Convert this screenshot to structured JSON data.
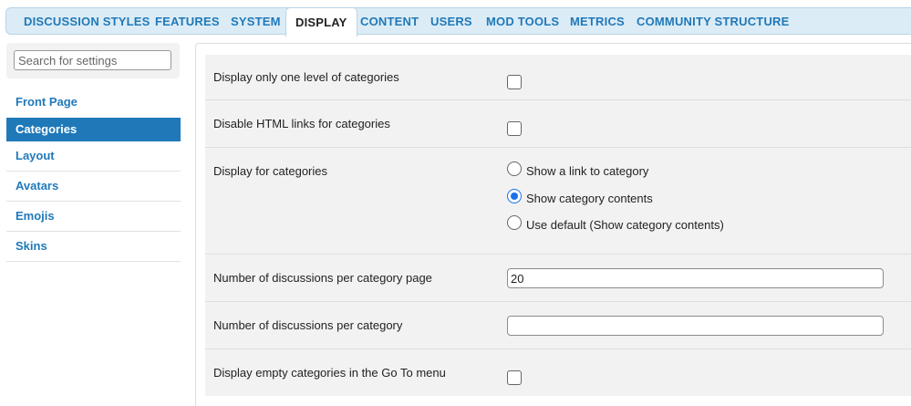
{
  "tabs": [
    {
      "label": "DISCUSSION STYLES",
      "active": false
    },
    {
      "label": "FEATURES",
      "active": false
    },
    {
      "label": "SYSTEM",
      "active": false
    },
    {
      "label": "DISPLAY",
      "active": true
    },
    {
      "label": "CONTENT",
      "active": false
    },
    {
      "label": "USERS",
      "active": false
    },
    {
      "label": "MOD TOOLS",
      "active": false
    },
    {
      "label": "METRICS",
      "active": false
    },
    {
      "label": "COMMUNITY STRUCTURE",
      "active": false
    }
  ],
  "sidebar": {
    "search_placeholder": "Search for settings",
    "items": [
      {
        "label": "Front Page",
        "active": false
      },
      {
        "label": "Categories",
        "active": true
      },
      {
        "label": "Layout",
        "active": false
      },
      {
        "label": "Avatars",
        "active": false
      },
      {
        "label": "Emojis",
        "active": false
      },
      {
        "label": "Skins",
        "active": false
      }
    ]
  },
  "settings": {
    "one_level": {
      "label": "Display only one level of categories",
      "checked": false
    },
    "disable_html": {
      "label": "Disable HTML links for categories",
      "checked": false
    },
    "display_for": {
      "label": "Display for categories",
      "options": [
        {
          "label": "Show a link to category",
          "checked": false
        },
        {
          "label": "Show category contents",
          "checked": true
        },
        {
          "label": "Use default (Show category contents)",
          "checked": false
        }
      ]
    },
    "per_page": {
      "label": "Number of discussions per category page",
      "value": "20"
    },
    "per_category": {
      "label": "Number of discussions per category",
      "value": ""
    },
    "empty_goto": {
      "label": "Display empty categories in the Go To menu",
      "checked": false
    }
  },
  "colors": {
    "accent": "#1f79b9",
    "radio_checked": "#1a73e8",
    "row_bg": "#f2f2f2"
  }
}
